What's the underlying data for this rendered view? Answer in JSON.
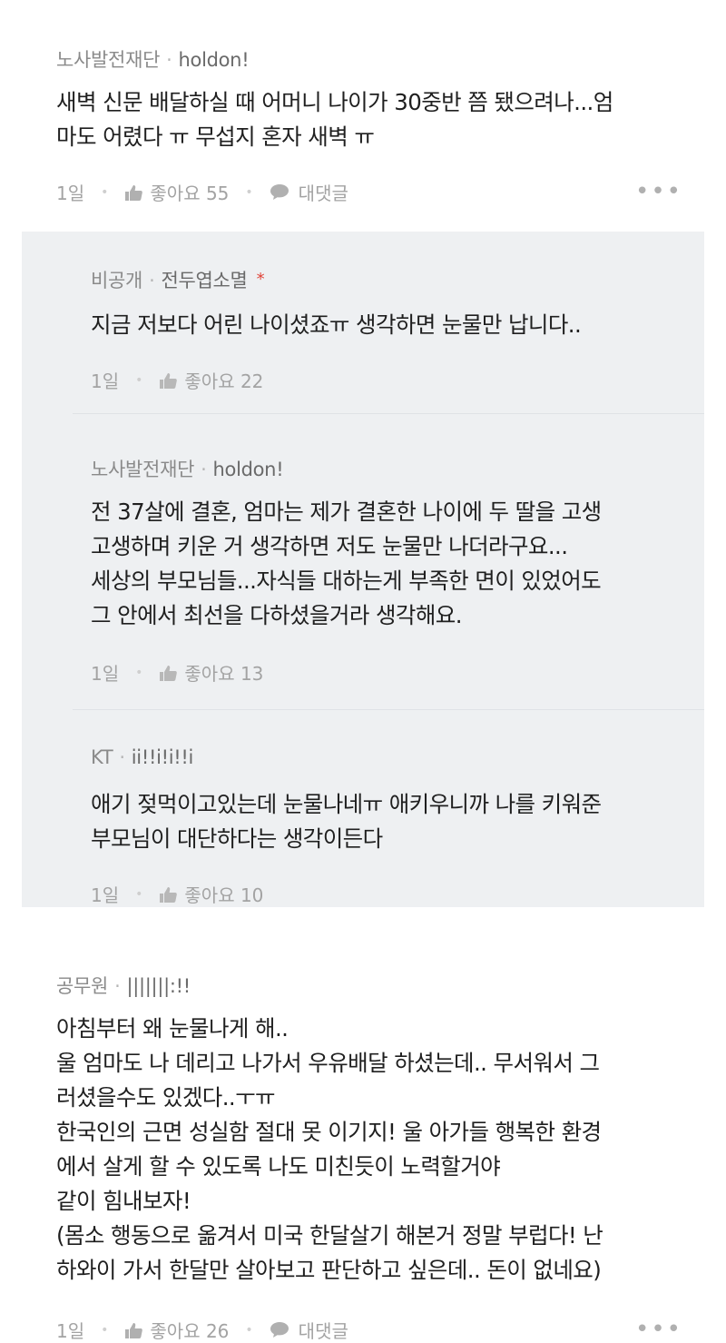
{
  "comments": [
    {
      "author": "노사발전재단",
      "nickname": "holdon!",
      "text": "새벽 신문 배달하실 때 어머니 나이가 30중반 쯤 됐으려나...엄\n마도 어렸다 ㅠ 무섭지 혼자 새벽 ㅠ",
      "time": "1일",
      "like_label": "좋아요 55",
      "reply_label": "대댓글",
      "more": "•••"
    },
    {
      "author": "공무원",
      "nickname": "|||||||:!!",
      "text": "아침부터 왜 눈물나게 해..\n울 엄마도 나 데리고 나가서 우유배달 하셨는데.. 무서워서 그\n러셨을수도 있겠다..ㅜㅠ\n한국인의 근면 성실함 절대 못 이기지! 울 아가들 행복한 환경\n에서 살게 할 수 있도록 나도 미친듯이 노력할거야\n같이 힘내보자!\n(몸소 행동으로 옮겨서 미국 한달살기 해본거 정말 부럽다! 난\n하와이 가서 한달만 살아보고 판단하고 싶은데.. 돈이 없네요)",
      "time": "1일",
      "like_label": "좋아요 26",
      "reply_label": "대댓글",
      "more": "•••"
    }
  ],
  "replies": [
    {
      "author": "비공개",
      "nickname": "전두엽소멸",
      "badge": "*",
      "text": "지금 저보다 어린 나이셨죠ㅠ 생각하면 눈물만 납니다..",
      "time": "1일",
      "like_label": "좋아요 22"
    },
    {
      "author": "노사발전재단",
      "nickname": "holdon!",
      "text": "전 37살에 결혼, 엄마는 제가 결혼한 나이에 두 딸을 고생\n고생하며 키운 거 생각하면 저도 눈물만 나더라구요...\n세상의 부모님들...자식들 대하는게 부족한 면이 있었어도\n그 안에서 최선을 다하셨을거라 생각해요.",
      "time": "1일",
      "like_label": "좋아요 13"
    },
    {
      "author": "KT",
      "nickname": "ii!!i!i!!i",
      "text": "애기 젖먹이고있는데 눈물나네ㅠ 애키우니까 나를 키워준\n부모님이 대단하다는 생각이든다",
      "time": "1일",
      "like_label": "좋아요 10"
    }
  ],
  "colors": {
    "reply_bg": "#eef0f2",
    "text": "#1f1f1f",
    "meta": "#8a8a8a",
    "badge": "#e0453a"
  },
  "icons": {
    "like": "thumbs-up-icon",
    "reply": "speech-bubble-icon",
    "more": "more-dots-icon"
  }
}
